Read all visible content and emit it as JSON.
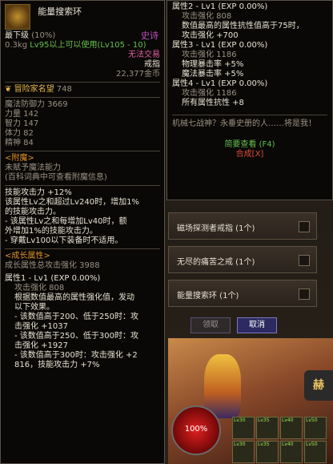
{
  "left": {
    "name": "能量搜索环",
    "grade": "最下级",
    "grade_pct": "(10%)",
    "rarity": "史诗",
    "weight": "0.3kg",
    "level_req": "Lv95以上可以使用(Lv105 - 10)",
    "trade": "无法交易",
    "type": "戒指",
    "price": "22,377金币",
    "fame_label": "冒险家名望",
    "fame_value": "748",
    "stats": [
      "魔法防御力 3669",
      "力量 142",
      "智力 147",
      "体力 82",
      "精神 84"
    ],
    "enchant_header": "<附魔>",
    "enchant_none": "未赋予魔法能力",
    "enchant_hint": "(百科词典中可查看附魔信息)",
    "skill": [
      "技能攻击力 +12%",
      "该属性Lv之和超过Lv240时，增加1%",
      "的技能攻击力。",
      "- 该属性Lv之和每增加Lv40时，额",
      "外增加1%的技能攻击力。",
      "- 穿戴Lv100以下装备时不适用。",
      ""
    ],
    "growth_header": "<成长属性>",
    "growth_total": "成长属性总攻击强化 3988",
    "attr1_header": "属性1 - Lv1 (EXP 0.00%)",
    "attr1": [
      "攻击强化 808",
      "根据数值最高的属性强化值，发动",
      "以下效果。",
      "- 该数值高于200、低于250时：攻",
      "击强化 +1037",
      "- 该数值高于250、低于300时：攻",
      "击强化 +1927",
      "- 该数值高于300时：攻击强化 +2",
      "816，技能攻击力 +7%",
      ""
    ]
  },
  "right": {
    "attr2_header": "属性2 - Lv1 (EXP 0.00%)",
    "attr2_l1": "攻击强化 808",
    "attr2_l2": "数值最高的属性抗性值高于75时，",
    "attr2_l3": "攻击强化 +700",
    "attr3_header": "属性3 - Lv1 (EXP 0.00%)",
    "attr3_l1": "攻击强化 1186",
    "attr3_l2": "物理暴击率 +5%",
    "attr3_l3": "魔法暴击率 +5%",
    "attr4_header": "属性4 - Lv1 (EXP 0.00%)",
    "attr4_l1": "攻击强化 1186",
    "attr4_l2": "所有属性抗性 +8",
    "flavor": "机械七战神？永垂史册的人……将是我！",
    "brief_view": "简要查看 (F4)",
    "synthesis": "合成[X]"
  },
  "panel": {
    "items": [
      "磁场探测者戒指 (1个)",
      "无尽的痛苦之戒 (1个)",
      "能量搜索环 (1个)"
    ],
    "claim": "领取",
    "cancel": "取消"
  },
  "scene": {
    "sign": "赫",
    "hp": "100%",
    "slot_lv": [
      "Lv30",
      "Lv35",
      "Lv40",
      "Lv50",
      "Lv30",
      "Lv35",
      "Lv40",
      "Lv50"
    ]
  },
  "colors": {
    "rarity_epic": "#c050c0",
    "level_req": "#66c04a",
    "trade_status": "#e060a0",
    "section_header": "#e0902a",
    "cancel_button": "#2c2a60"
  }
}
